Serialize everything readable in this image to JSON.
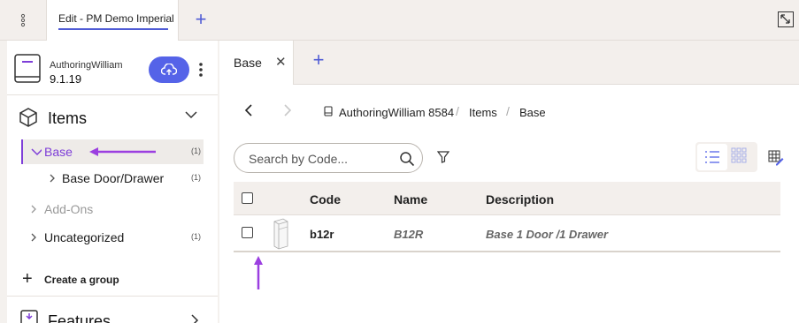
{
  "topbar": {
    "doc_tab_label": "Edit - PM Demo Imperial",
    "add_tab_glyph": "+"
  },
  "project": {
    "name": "AuthoringWilliam",
    "version": "9.1.19"
  },
  "sidebar": {
    "items_title": "Items",
    "tree": [
      {
        "label": "Base",
        "count": "(1)"
      },
      {
        "label": "Base Door/Drawer",
        "count": "(1)"
      },
      {
        "label": "Add-Ons",
        "count": ""
      },
      {
        "label": "Uncategorized",
        "count": "(1)"
      }
    ],
    "create_group": "Create a group",
    "features_title": "Features"
  },
  "main": {
    "tab_label": "Base",
    "breadcrumb": [
      "AuthoringWilliam 8584",
      "Items",
      "Base"
    ],
    "breadcrumb_sep": "/",
    "search_placeholder": "Search by Code...",
    "table": {
      "headers": [
        "Code",
        "Name",
        "Description"
      ],
      "rows": [
        {
          "code": "b12r",
          "name": "B12R",
          "description": "Base 1 Door /1 Drawer"
        }
      ]
    }
  },
  "colors": {
    "accent": "#4f5bd5",
    "selection": "#7e3ed8",
    "annotation": "#9b3fe0",
    "panel_bg": "#f3efec"
  },
  "icons": [
    "kebab-icon",
    "add-icon",
    "expand-icon",
    "book-icon",
    "upload-cloud-icon",
    "cube-icon",
    "chevron-down-icon",
    "chevron-right-icon",
    "plus-icon",
    "features-icon",
    "close-icon",
    "back-icon",
    "forward-icon",
    "document-icon",
    "search-icon",
    "filter-icon",
    "list-view-icon",
    "grid-view-icon",
    "edit-grid-icon"
  ]
}
